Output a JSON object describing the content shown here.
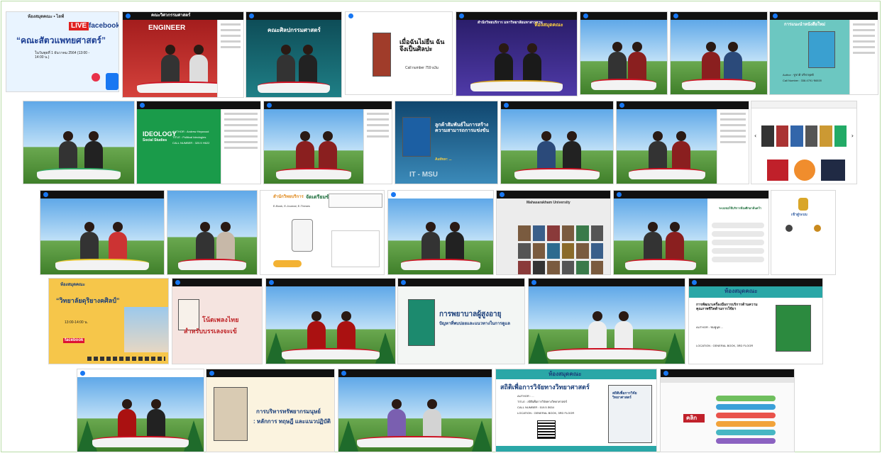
{
  "gallery": {
    "title": "",
    "r1c1": {
      "small": "ห้องสมุดคณะ • ไลฟ์",
      "live_badge": "LIVE",
      "platform": "facebook",
      "headline": "“คณะสัตวแพทยศาสตร์”",
      "sub": "ในวันพุธที่ 1 ธันวาคม 2564 (13:00 - 14:00 น.)"
    },
    "r1c2": {
      "sign": "ENGINEER",
      "banner": "คณะวิศวกรรมศาสตร์"
    },
    "r1c3": {
      "banner": "คณะศิลปกรรมศาสตร์"
    },
    "r1c4": {
      "headline": "เมื่อฉันไม่ยืน ฉันจึงเป็นศิลปะ",
      "meta": "Call number 759 ผ3ม"
    },
    "r1c5": {
      "top": "สำนักวิทยบริการ มหาวิทยาลัยมหาสารคาม",
      "banner": "ห้องสมุดคณะ"
    },
    "r1c8": {
      "title": "การแนะนำหนังสือใหม่",
      "author": "Author : ชูชาติ ปรีชาพุทธิ",
      "callno": "Call Number : 338.4791 ช653ก"
    },
    "r2c2": {
      "brand": "IDEOLOGY",
      "line1": "Social Studies",
      "line2": "AUTHOR : Andrew Heywood",
      "line3": "TITLE : Political Ideologies",
      "callno": "CALL NUMBER : 320.5 H622"
    },
    "r2c4": {
      "headline": "ลูกค้าสัมพันธ์ในการสร้างความสามารถการแข่งขัน",
      "meta": "Author: ...",
      "footer": "IT - MSU"
    },
    "r3c3": {
      "brand": "สำนักวิทยบริการ",
      "headline": "จัดเตรียมข้อมูล",
      "note": "E-Book, E-Journal, E-Theses"
    },
    "r3c5": {
      "header": "Mahasarakham University"
    },
    "r3c7": {
      "header": "ระบบขอใช้บริการห้องศึกษาค้นคว้า"
    },
    "r3c8": {
      "login": "เข้าสู่ระบบ"
    },
    "r4c1": {
      "small": "ห้องสมุดคณะ",
      "headline": "“วิทยาลัยดุริยางคศิลป์”",
      "time": "13:00-14:00 น.",
      "platform": "facebook"
    },
    "r4c2": {
      "headline": "โน้ตเพลงไทย",
      "sub": "สำหรับบรรเลงจะเข้"
    },
    "r4c4": {
      "headline": "การพยาบาลผู้สูงอายุ",
      "sub": "ปัญหาที่พบบ่อยและแนวทางในการดูแล"
    },
    "r4c6": {
      "brand": "ห้องสมุดคณะ",
      "headline": "การพัฒนาเครื่องมือการบริการด้านความคุณภาพชีวิตด้านการใช้ยา",
      "author": "AUTHOR : ชมพูนุท ...",
      "location": "LOCATION : GENERAL BOOK, 3RD FLOOR"
    },
    "r5c2": {
      "headline": "การบริหารทรัพยากรมนุษย์",
      "sub": ": หลักการ ทฤษฎี และแนวปฏิบัติ"
    },
    "r5c4": {
      "brand": "ห้องสมุดคณะ",
      "headline": "สถิติเพื่อการวิจัยทางวิทยาศาสตร์",
      "author": "AUTHOR : ...",
      "title_line": "TITLE : สถิติเพื่อการวิจัยทางวิทยาศาสตร์",
      "callno": "CALL NUMBER : 519.5 ส634",
      "location": "LOCATION : GENERAL BOOK, 3RD FLOOR",
      "book": "สถิติเพื่อการวิจัย วิทยาศาสตร์"
    },
    "r5c5": {
      "click": "คลิก"
    }
  }
}
